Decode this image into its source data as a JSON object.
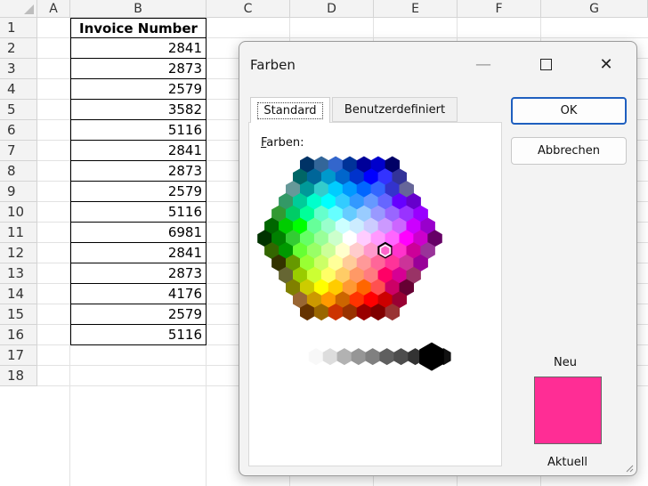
{
  "sheet": {
    "columns": [
      "A",
      "B",
      "C",
      "D",
      "E",
      "F",
      "G"
    ],
    "rows": [
      "1",
      "2",
      "3",
      "4",
      "5",
      "6",
      "7",
      "8",
      "9",
      "10",
      "11",
      "12",
      "13",
      "14",
      "15",
      "16",
      "17",
      "18"
    ],
    "header_cell": "Invoice Number",
    "values": [
      "2841",
      "2873",
      "2579",
      "3582",
      "5116",
      "2841",
      "2873",
      "2579",
      "5116",
      "6981",
      "2841",
      "2873",
      "4176",
      "2579",
      "5116"
    ]
  },
  "dialog": {
    "title": "Farben",
    "minimize_glyph": "—",
    "maximize_glyph": "□",
    "close_glyph": "✕",
    "tabs": [
      "Standard",
      "Benutzerdefiniert"
    ],
    "colors_label_accel": "F",
    "colors_label_rest": "arben:",
    "ok_label": "OK",
    "cancel_label": "Abbrechen",
    "new_label": "Neu",
    "current_label": "Aktuell",
    "selected_color": "#ff2d95",
    "icons": [
      "minimize-icon",
      "maximize-icon",
      "close-icon",
      "resize-grip-icon"
    ]
  },
  "palette": {
    "rows": [
      [
        "#003366",
        "#336699",
        "#3366cc",
        "#003399",
        "#000099",
        "#0000cc",
        "#000066"
      ],
      [
        "#006666",
        "#006699",
        "#0099cc",
        "#0066cc",
        "#0033cc",
        "#0000ff",
        "#3333ff",
        "#333399"
      ],
      [
        "#669999",
        "#009999",
        "#33cccc",
        "#00ccff",
        "#0099ff",
        "#0066ff",
        "#3366ff",
        "#3333cc",
        "#666699"
      ],
      [
        "#339966",
        "#00cc99",
        "#00ffcc",
        "#00ffff",
        "#33ccff",
        "#3399ff",
        "#6699ff",
        "#6666ff",
        "#6600ff",
        "#6600cc"
      ],
      [
        "#339933",
        "#00cc66",
        "#00ff99",
        "#66ffcc",
        "#66ffff",
        "#66ccff",
        "#99ccff",
        "#9999ff",
        "#9966ff",
        "#9933ff",
        "#9900ff"
      ],
      [
        "#006600",
        "#00cc00",
        "#00ff00",
        "#66ff99",
        "#99ffcc",
        "#ccffff",
        "#ccecff",
        "#ccccff",
        "#cc99ff",
        "#cc66ff",
        "#cc00ff",
        "#9900cc"
      ],
      [
        "#003300",
        "#008000",
        "#33cc33",
        "#66ff66",
        "#99ff99",
        "#ccffcc",
        "#ffffff",
        "#ffccff",
        "#ff99ff",
        "#ff66ff",
        "#ff00ff",
        "#cc00cc",
        "#660066"
      ],
      [
        "#336600",
        "#009900",
        "#66ff33",
        "#99ff66",
        "#ccff99",
        "#ffffcc",
        "#ffcccc",
        "#ff99cc",
        "#ff66cc",
        "#ff33cc",
        "#cc0099",
        "#993399"
      ],
      [
        "#333300",
        "#669900",
        "#99ff33",
        "#ccff66",
        "#ffff99",
        "#ffcc99",
        "#ff9999",
        "#ff6699",
        "#ff3399",
        "#cc3399",
        "#990099"
      ],
      [
        "#666633",
        "#99cc00",
        "#ccff33",
        "#ffff66",
        "#ffcc66",
        "#ff9966",
        "#ff7c80",
        "#ff0066",
        "#d60093",
        "#993366"
      ],
      [
        "#808000",
        "#cccc00",
        "#ffff00",
        "#ffcc00",
        "#ff9933",
        "#ff6600",
        "#ff5050",
        "#cc0066",
        "#660033"
      ],
      [
        "#996633",
        "#cc9900",
        "#ff9900",
        "#cc6600",
        "#ff3300",
        "#ff0000",
        "#cc0000",
        "#990033"
      ],
      [
        "#663300",
        "#996600",
        "#cc3300",
        "#993300",
        "#990000",
        "#800000",
        "#993333"
      ]
    ],
    "grays": [
      "#ffffff",
      "#f8f8f8",
      "#dddddd",
      "#b2b2b2",
      "#969696",
      "#808080",
      "#5f5f5f",
      "#4d4d4d",
      "#333333",
      "#1c1c1c",
      "#111111",
      "#000000"
    ],
    "selected": [
      7,
      8
    ]
  }
}
